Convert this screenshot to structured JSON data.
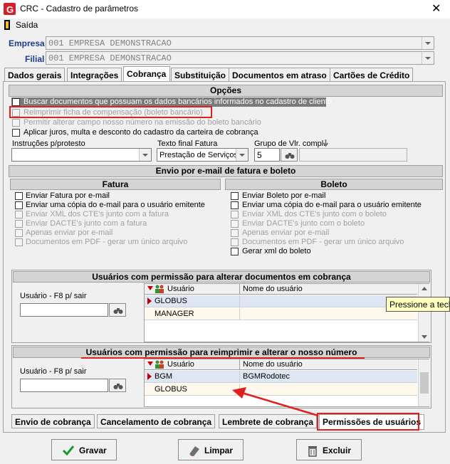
{
  "window": {
    "title": "CRC - Cadastro de parâmetros",
    "close": "✕"
  },
  "menu": {
    "exit": "Saída"
  },
  "form": {
    "empresa_label": "Empresa",
    "empresa_value": "001 EMPRESA DEMONSTRACAO",
    "filial_label": "Filial",
    "filial_value": "001 EMPRESA DEMONSTRACAO"
  },
  "tabs": [
    "Dados gerais",
    "Integrações",
    "Cobrança",
    "Substituição",
    "Documentos em atraso",
    "Cartões de Crédito"
  ],
  "active_tab": "Cobrança",
  "opcoes": {
    "title": "Opções",
    "items": [
      {
        "label": "Buscar documentos que possuam os dados bancários informados no cadastro de cliente",
        "enabled": true,
        "checked": false
      },
      {
        "label": "Reimprimir ficha de compensação (boleto bancário)",
        "enabled": false,
        "checked": false
      },
      {
        "label": "Permitir alterar campo nosso número na emissão do boleto bancário",
        "enabled": false,
        "checked": false
      },
      {
        "label": "Aplicar juros, multa e desconto do cadastro da carteira de cobrança",
        "enabled": true,
        "checked": false
      }
    ],
    "instrucoes_label": "Instruções p/protesto",
    "instrucoes_value": "",
    "texto_final_label": "Texto final Fatura",
    "texto_final_value": "Prestação de Serviços",
    "grupo_label": "Grupo de Vlr. compl.",
    "grupo_value": "5"
  },
  "envio": {
    "title": "Envio por e-mail de fatura e boleto",
    "fatura": {
      "title": "Fatura",
      "items": [
        {
          "label": "Enviar Fatura por e-mail",
          "enabled": true
        },
        {
          "label": "Enviar uma cópia do e-mail para o usuário emitente",
          "enabled": true
        },
        {
          "label": "Enviar XML dos CTE's  junto com a fatura",
          "enabled": false
        },
        {
          "label": "Enviar DACTE's junto com a fatura",
          "enabled": false
        },
        {
          "label": "Apenas enviar por e-mail",
          "enabled": false
        },
        {
          "label": "Documentos em PDF - gerar um único arquivo",
          "enabled": false
        }
      ]
    },
    "boleto": {
      "title": "Boleto",
      "items": [
        {
          "label": "Enviar Boleto por e-mail",
          "enabled": true
        },
        {
          "label": "Enviar uma cópia do e-mail para o usuário emitente",
          "enabled": true
        },
        {
          "label": "Enviar XML dos CTE's  junto com o boleto",
          "enabled": false
        },
        {
          "label": "Enviar DACTE's junto com o boleto",
          "enabled": false
        },
        {
          "label": "Apenas enviar por e-mail",
          "enabled": false
        },
        {
          "label": "Documentos em PDF - gerar um único arquivo",
          "enabled": false
        },
        {
          "label": "Gerar xml do boleto",
          "enabled": true
        }
      ]
    }
  },
  "perm1": {
    "title": "Usuários com permissão para alterar documentos em cobrança",
    "user_label": "Usuário - F8 p/ sair",
    "col_user": "Usuário",
    "col_name": "Nome do usuário",
    "rows": [
      {
        "user": "GLOBUS",
        "name": ""
      },
      {
        "user": "MANAGER",
        "name": ""
      }
    ]
  },
  "tooltip": "Pressione a tecla",
  "perm2": {
    "title": "Usuários com permissão para reimprimir e alterar o nosso número",
    "user_label": "Usuário - F8 p/ sair",
    "col_user": "Usuário",
    "col_name": "Nome do usuário",
    "rows": [
      {
        "user": "BGM",
        "name": "BGMRodotec"
      },
      {
        "user": "GLOBUS",
        "name": ""
      }
    ]
  },
  "subtabs": [
    "Envio de cobrança",
    "Cancelamento de cobrança",
    "Lembrete de cobrança",
    "Permissões de usuários"
  ],
  "active_subtab": "Permissões de usuários",
  "buttons": {
    "save": "Gravar",
    "clear": "Limpar",
    "delete": "Excluir"
  },
  "colors": {
    "accent_red": "#e0201f",
    "label_blue": "#1f3b8f",
    "selected_row": "#dde6f2"
  }
}
